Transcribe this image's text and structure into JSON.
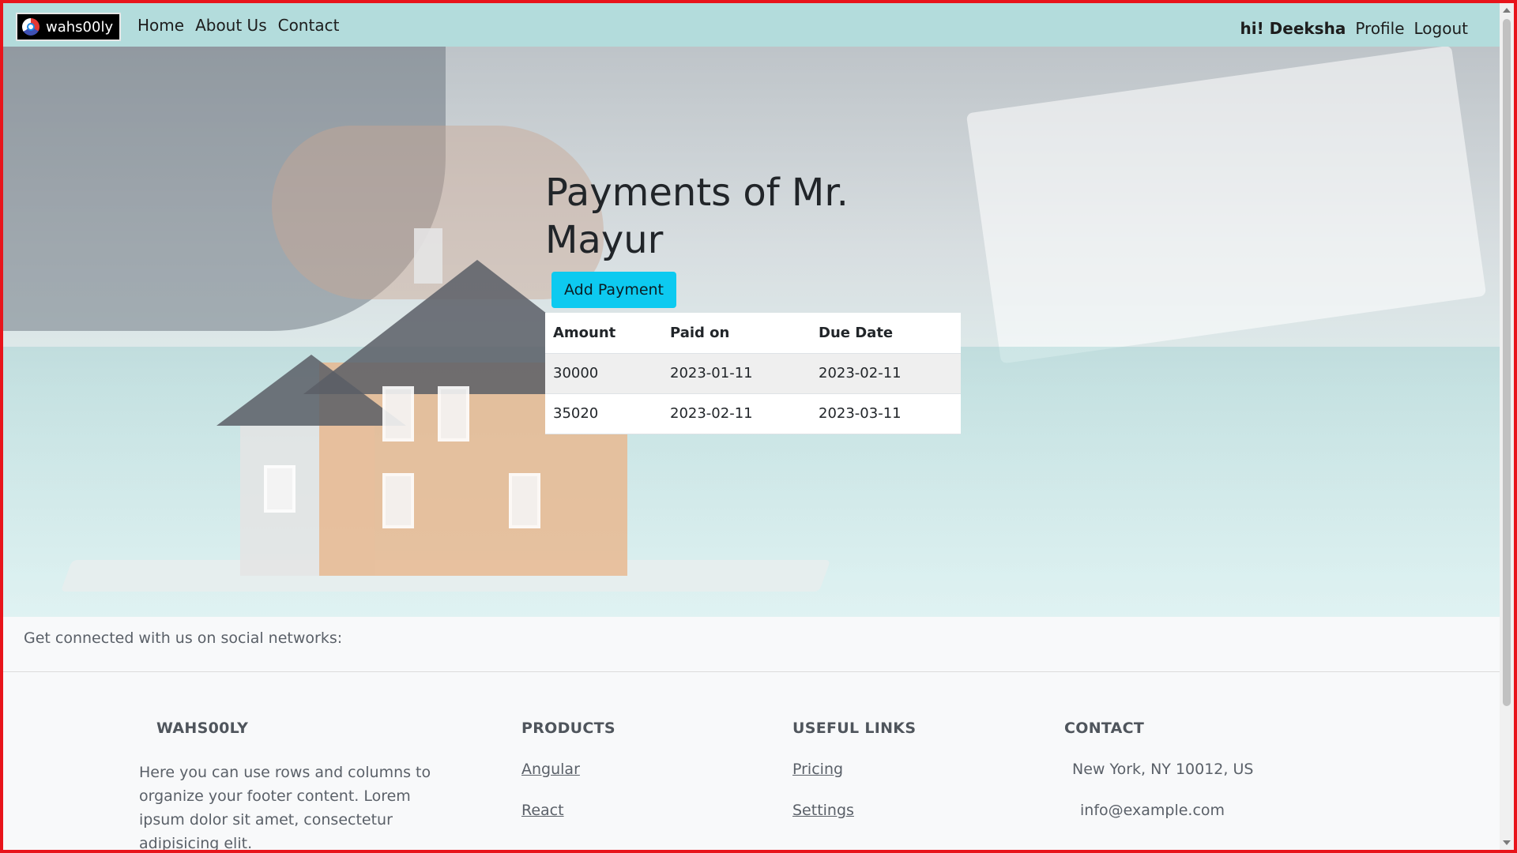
{
  "navbar": {
    "brand": "wahs00ly",
    "links": [
      "Home",
      "About Us",
      "Contact"
    ],
    "greeting": "hi! Deeksha",
    "profile": "Profile",
    "logout": "Logout"
  },
  "main": {
    "title": "Payments of Mr. Mayur",
    "add_button": "Add Payment",
    "table": {
      "headers": [
        "Amount",
        "Paid on",
        "Due Date"
      ],
      "rows": [
        [
          "30000",
          "2023-01-11",
          "2023-02-11"
        ],
        [
          "35020",
          "2023-02-11",
          "2023-03-11"
        ]
      ]
    }
  },
  "footer": {
    "social_text": "Get connected with us on social networks:",
    "brand_heading": "WAHS00LY",
    "brand_text": "Here you can use rows and columns to organize your footer content. Lorem ipsum dolor sit amet, consectetur adipisicing elit.",
    "products_heading": "PRODUCTS",
    "products": [
      "Angular",
      "React"
    ],
    "useful_heading": "USEFUL LINKS",
    "useful": [
      "Pricing",
      "Settings"
    ],
    "contact_heading": "CONTACT",
    "contact": [
      "New York, NY 10012, US",
      "info@example.com"
    ]
  },
  "colors": {
    "navbar_bg": "#b3dcdc",
    "button_bg": "#0dcaf0",
    "frame_border": "#e8141b"
  }
}
